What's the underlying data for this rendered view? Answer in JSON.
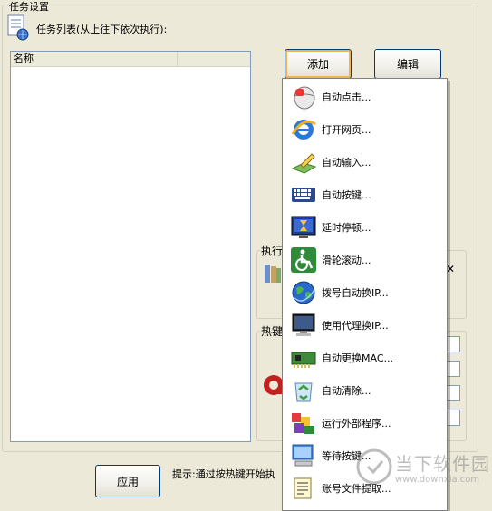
{
  "group": {
    "title": "任务设置"
  },
  "tasklist": {
    "header": "任务列表(从上往下依次执行):",
    "columns": [
      "名称",
      ""
    ]
  },
  "buttons": {
    "add": "添加",
    "edit": "编辑",
    "apply": "应用"
  },
  "side": {
    "exec_label": "执行",
    "hotkey_label": "热键"
  },
  "hint": "提示:通过按热键开始执",
  "menu": {
    "items": [
      {
        "label": "自动点击...",
        "icon": "mouse-icon"
      },
      {
        "label": "打开网页...",
        "icon": "ie-icon"
      },
      {
        "label": "自动输入...",
        "icon": "pen-input-icon"
      },
      {
        "label": "自动按键...",
        "icon": "keyboard-icon"
      },
      {
        "label": "延时停顿...",
        "icon": "hourglass-icon"
      },
      {
        "label": "滑轮滚动...",
        "icon": "wheelchair-icon"
      },
      {
        "label": "拨号自动换IP...",
        "icon": "globe-icon"
      },
      {
        "label": "使用代理换IP...",
        "icon": "monitor-icon"
      },
      {
        "label": "自动更换MAC...",
        "icon": "network-card-icon"
      },
      {
        "label": "自动清除...",
        "icon": "recycle-icon"
      },
      {
        "label": "运行外部程序...",
        "icon": "blocks-icon"
      },
      {
        "label": "等待按键...",
        "icon": "computer-icon"
      },
      {
        "label": "账号文件提取...",
        "icon": "file-list-icon"
      }
    ]
  },
  "watermark": {
    "brand": "当下软件园",
    "url": "www.downxia.com"
  }
}
